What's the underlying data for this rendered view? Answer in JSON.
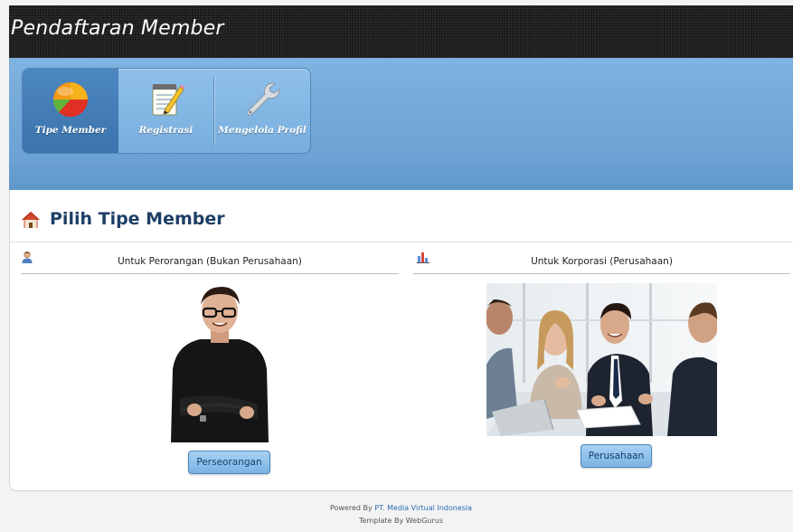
{
  "header": {
    "title": "Pendaftaran Member"
  },
  "nav": {
    "items": [
      {
        "label": "Tipe Member",
        "icon": "pie-chart-icon",
        "active": true
      },
      {
        "label": "Registrasi",
        "icon": "notepad-pencil-icon",
        "active": false
      },
      {
        "label": "Mengelola Profil",
        "icon": "wrench-icon",
        "active": false
      }
    ]
  },
  "main": {
    "section_title": "Pilih Tipe Member",
    "section_icon": "home-icon",
    "columns": [
      {
        "header": "Untuk Perorangan (Bukan Perusahaan)",
        "header_icon": "person-icon",
        "photo": "man-portrait-photo",
        "button_label": "Perseorangan"
      },
      {
        "header": "Untuk Korporasi (Perusahaan)",
        "header_icon": "bar-chart-icon",
        "photo": "business-meeting-photo",
        "button_label": "Perusahaan"
      }
    ]
  },
  "footer": {
    "powered_prefix": "Powered By ",
    "powered_link": "PT. Media Virtual Indonesia",
    "template_by": "Template By WebGurus"
  },
  "colors": {
    "nav_blue": "#76abda",
    "active_tab": "#3b74ad",
    "title_navy": "#1e3f66",
    "button_blue": "#7ab3e4",
    "header_dark": "#1b1b1b"
  }
}
